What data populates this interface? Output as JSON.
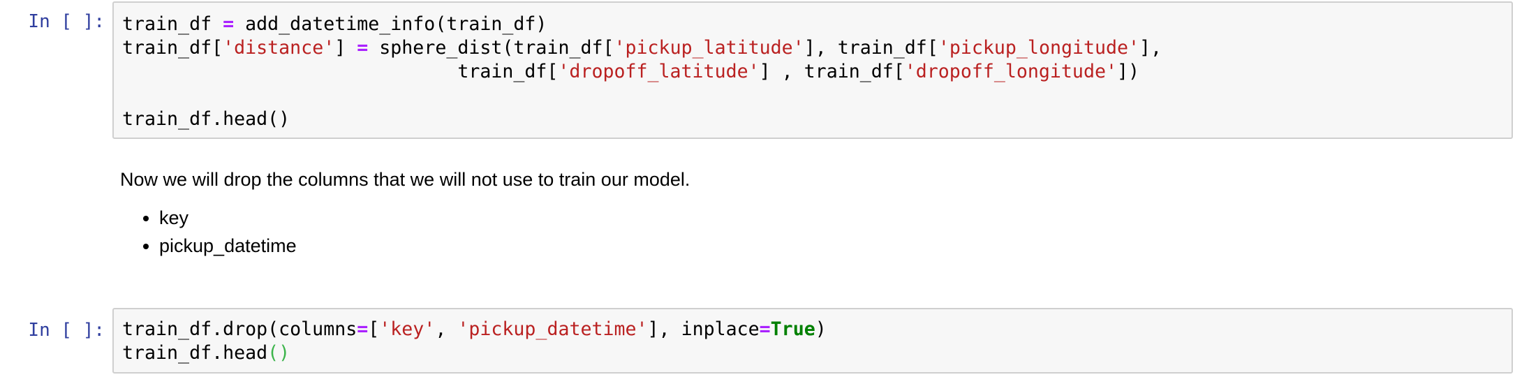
{
  "cells": [
    {
      "prompt": "In [ ]:",
      "lines": [
        [
          [
            "t",
            "train_df "
          ],
          [
            "op",
            "="
          ],
          [
            "t",
            " add_datetime_info(train_df)"
          ]
        ],
        [
          [
            "t",
            "train_df["
          ],
          [
            "s",
            "'distance'"
          ],
          [
            "t",
            "] "
          ],
          [
            "op",
            "="
          ],
          [
            "t",
            " sphere_dist(train_df["
          ],
          [
            "s",
            "'pickup_latitude'"
          ],
          [
            "t",
            "], train_df["
          ],
          [
            "s",
            "'pickup_longitude'"
          ],
          [
            "t",
            "],"
          ]
        ],
        [
          [
            "t",
            "                              train_df["
          ],
          [
            "s",
            "'dropoff_latitude'"
          ],
          [
            "t",
            "] , train_df["
          ],
          [
            "s",
            "'dropoff_longitude'"
          ],
          [
            "t",
            "])"
          ]
        ],
        [],
        [
          [
            "t",
            "train_df.head()"
          ]
        ]
      ]
    },
    {
      "prompt": "In [ ]:",
      "lines": [
        [
          [
            "t",
            "train_df.drop(columns"
          ],
          [
            "op",
            "="
          ],
          [
            "t",
            "["
          ],
          [
            "s",
            "'key'"
          ],
          [
            "t",
            ", "
          ],
          [
            "s",
            "'pickup_datetime'"
          ],
          [
            "t",
            "], inplace"
          ],
          [
            "op",
            "="
          ],
          [
            "kw",
            "True"
          ],
          [
            "t",
            ")"
          ]
        ],
        [
          [
            "t",
            "train_df.head"
          ],
          [
            "pa",
            "()"
          ]
        ]
      ]
    }
  ],
  "markdown": {
    "paragraph": "Now we will drop the columns that we will not use to train our model.",
    "items": [
      "key",
      "pickup_datetime"
    ]
  },
  "colors": {
    "prompt": "#303f9f",
    "string": "#ba2121",
    "operator": "#aa22ff",
    "keyword": "#008000",
    "cell_bg": "#f7f7f7",
    "cell_border": "#cfcfcf"
  }
}
